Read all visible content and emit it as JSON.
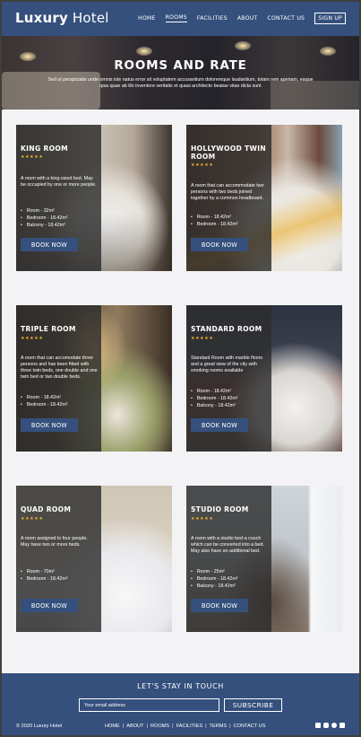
{
  "header": {
    "logo_bold": "Luxury",
    "logo_light": " Hotel",
    "nav": [
      "HOME",
      "ROOMS",
      "FACILITIES",
      "ABOUT",
      "CONTACT US"
    ],
    "signup": "SIGN UP"
  },
  "hero": {
    "title": "ROOMS AND RATE",
    "text": "Sed ut perspiciatis unde omnis iste natus error sit voluptatem accusantium doloremque laudantium, totam rem aperiam, eaque ipsa quae ab illo inventore veritatis et quasi architecto beatae vitae dicta sunt"
  },
  "rooms": [
    {
      "title": "KING ROOM",
      "stars": "★★★★★",
      "desc": "A room with a king-sized bed. May be occupied by one or more people.",
      "features": [
        "Room - 32m²",
        "Bedroom - 18.42m²",
        "Balcony - 18.42m²"
      ],
      "button": "BOOK NOW"
    },
    {
      "title": "HOLLYWOOD TWIN ROOM",
      "stars": "★★★★★",
      "desc": "A room that can accommodate two persons with two beds joined together by a common headboard.",
      "features": [
        "Room - 18.42m²",
        "Bedroom - 18.42m²"
      ],
      "button": "BOOK NOW"
    },
    {
      "title": "TRIPLE ROOM",
      "stars": "★★★★★",
      "desc": "A room that can accomodate three persons and has been fitted with three twin beds, one double and one twin bed or two double beds.",
      "features": [
        "Room - 18.42m²",
        "Bedroom - 18.42m²"
      ],
      "button": "BOOK NOW"
    },
    {
      "title": "STANDARD ROOM",
      "stars": "★★★★★",
      "desc": "Standard Room with marble floors and a great view of the city with smoking rooms available",
      "features": [
        "Room - 18.42m²",
        "Bedroom - 18.42m²",
        "Balcony - 18.42m²"
      ],
      "button": "BOOK NOW"
    },
    {
      "title": "QUAD ROOM",
      "stars": "★★★★★",
      "desc": "A room assigned to four people. May have two or more beds.",
      "features": [
        "Room - 70m²",
        "Bedroom - 18.42m²"
      ],
      "button": "BOOK NOW"
    },
    {
      "title": "STUDIO ROOM",
      "stars": "★★★★★",
      "desc": "A room with a studio bed-a couch which can be converted into a bed. May also have an additional bed.",
      "features": [
        "Room - 25m²",
        "Bedroom - 18.42m²",
        "Balcony - 18.42m²"
      ],
      "button": "BOOK NOW"
    }
  ],
  "footer": {
    "heading": "LET'S STAY IN TOUCH",
    "email_placeholder": "Your email address",
    "subscribe": "SUBSCRIBE",
    "copyright": "© 2020 Luxury Hotel",
    "links": [
      "HOME",
      "ABOUT",
      "ROOMS",
      "FACILITIES",
      "TERMS",
      "CONTACT US"
    ],
    "social_icons": [
      "linkedin-icon",
      "instagram-icon",
      "twitter-icon",
      "facebook-icon"
    ]
  },
  "colors": {
    "brand": "#35507d",
    "star": "#f5b82a",
    "panel": "#2d2d2d"
  }
}
